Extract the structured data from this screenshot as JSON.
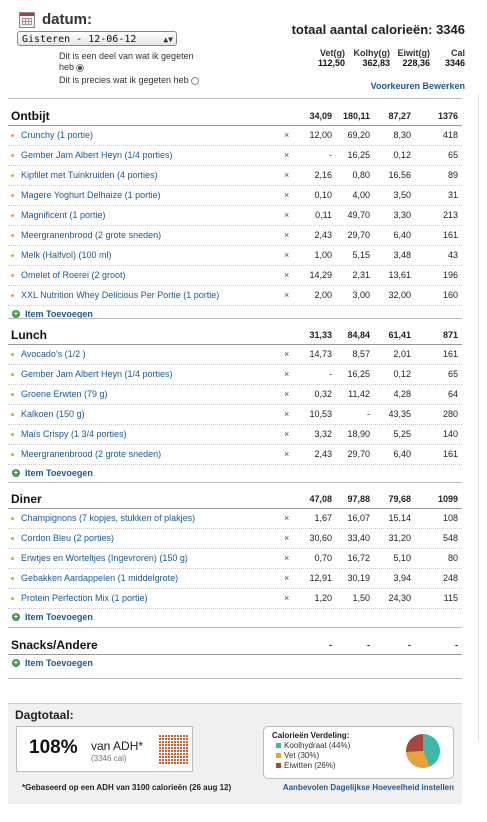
{
  "header": {
    "datum_label": "datum:",
    "date_select": "Gisteren - 12-06-12",
    "radio_partial_1": "Dit is een deel van wat ik gegeten",
    "radio_partial_2": "heb",
    "radio_exact": "Dit is precies wat ik gegeten heb",
    "total_title": "totaal aantal calorieën: 3346",
    "columns": [
      "Vet(g)",
      "Kolhy(g)",
      "Eiwit(g)",
      "Cal"
    ],
    "totals": [
      "112,50",
      "362,83",
      "228,36",
      "3346"
    ],
    "preferences_link": "Voorkeuren Bewerken"
  },
  "meals": {
    "ontbijt": {
      "title": "Ontbijt",
      "totals": [
        "34,09",
        "180,11",
        "87,27",
        "1376"
      ],
      "items": [
        {
          "name": "Crunchy (1 portie)",
          "v": [
            "12,00",
            "69,20",
            "8,30",
            "418"
          ]
        },
        {
          "name": "Gember Jam Albert Heyn (1/4 porties)",
          "v": [
            "-",
            "16,25",
            "0,12",
            "65"
          ]
        },
        {
          "name": "Kipfilet met Tuinkruiden (4 porties)",
          "v": [
            "2,16",
            "0,80",
            "16,56",
            "89"
          ]
        },
        {
          "name": "Magere Yoghurt Delhaize (1 portie)",
          "v": [
            "0,10",
            "4,00",
            "3,50",
            "31"
          ]
        },
        {
          "name": "Magnificent (1 portie)",
          "v": [
            "0,11",
            "49,70",
            "3,30",
            "213"
          ]
        },
        {
          "name": "Meergranenbrood (2 grote sneden)",
          "v": [
            "2,43",
            "29,70",
            "6,40",
            "161"
          ]
        },
        {
          "name": "Melk (Halfvol) (100 ml)",
          "v": [
            "1,00",
            "5,15",
            "3,48",
            "43"
          ]
        },
        {
          "name": "Omelet of Roerei (2 groot)",
          "v": [
            "14,29",
            "2,31",
            "13,61",
            "196"
          ]
        },
        {
          "name": "XXL Nutrition Whey Delicious Per Portie (1 portie)",
          "v": [
            "2,00",
            "3,00",
            "32,00",
            "160"
          ]
        }
      ]
    },
    "lunch": {
      "title": "Lunch",
      "totals": [
        "31,33",
        "84,84",
        "61,41",
        "871"
      ],
      "items": [
        {
          "name": "Avocado's (1/2 )",
          "v": [
            "14,73",
            "8,57",
            "2,01",
            "161"
          ]
        },
        {
          "name": "Gember Jam Albert Heyn (1/4 porties)",
          "v": [
            "-",
            "16,25",
            "0,12",
            "65"
          ]
        },
        {
          "name": "Groene Erwten (79 g)",
          "v": [
            "0,32",
            "11,42",
            "4,28",
            "64"
          ]
        },
        {
          "name": "Kalkoen (150 g)",
          "v": [
            "10,53",
            "-",
            "43,35",
            "280"
          ]
        },
        {
          "name": "Maïs Crispy (1 3/4 porties)",
          "v": [
            "3,32",
            "18,90",
            "5,25",
            "140"
          ]
        },
        {
          "name": "Meergranenbrood (2 grote sneden)",
          "v": [
            "2,43",
            "29,70",
            "6,40",
            "161"
          ]
        }
      ]
    },
    "diner": {
      "title": "Diner",
      "totals": [
        "47,08",
        "97,88",
        "79,68",
        "1099"
      ],
      "items": [
        {
          "name": "Champignons (7 kopjes, stukken of plakjes)",
          "v": [
            "1,67",
            "16,07",
            "15,14",
            "108"
          ]
        },
        {
          "name": "Cordon Bleu (2 porties)",
          "v": [
            "30,60",
            "33,40",
            "31,20",
            "548"
          ]
        },
        {
          "name": "Erwtjes en Worteltjes (Ingevroren) (150 g)",
          "v": [
            "0,70",
            "16,72",
            "5,10",
            "80"
          ]
        },
        {
          "name": "Gebakken Aardappelen (1 middelgrote)",
          "v": [
            "12,91",
            "30,19",
            "3,94",
            "248"
          ]
        },
        {
          "name": "Protein Perfection Mix (1 portie)",
          "v": [
            "1,20",
            "1,50",
            "24,30",
            "115"
          ]
        }
      ]
    },
    "snacks": {
      "title": "Snacks/Andere",
      "totals": [
        "-",
        "-",
        "-",
        "-"
      ],
      "items": []
    }
  },
  "remove_symbol": "×",
  "add_item_label": "Item Toevoegen",
  "dagtotaal": {
    "title": "Dagtotaal:",
    "percent": "108%",
    "van_adh": "van ADH*",
    "cal_sub": "(3346 cal)",
    "verdeling_title": "Calorieën Verdeling:",
    "legend": [
      {
        "label": "Koolhydraat (44%)",
        "color": "#3cb9a8",
        "pct": 44
      },
      {
        "label": "Vet (30%)",
        "color": "#e8a23a",
        "pct": 30
      },
      {
        "label": "Eiwitten (26%)",
        "color": "#a8453c",
        "pct": 26
      }
    ],
    "footnote": "*Gebaseerd op een ADH van 3100 calorieën (26 aug 12)",
    "recommended_link": "Aanbevolen Dagelijkse Hoeveelheid instellen"
  },
  "colors": {
    "link": "#1a5a9a",
    "bullet": "#e8a23a",
    "add": "#3b9a4a",
    "adh_grid": "#e05a2a"
  }
}
